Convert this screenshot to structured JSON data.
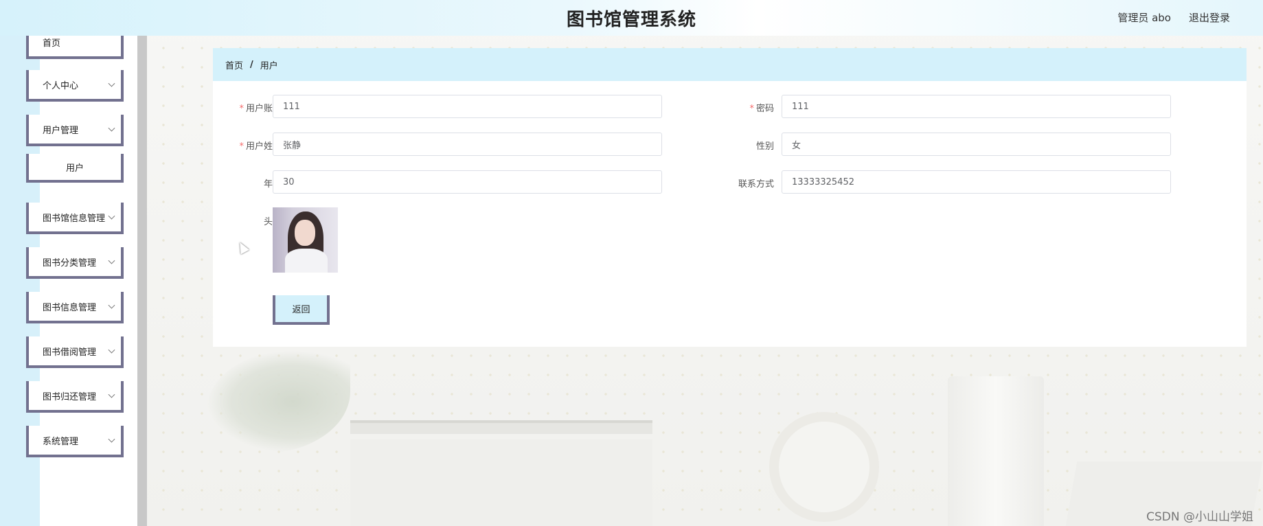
{
  "header": {
    "title": "图书馆管理系统",
    "user_label": "管理员 abo",
    "logout_label": "退出登录"
  },
  "sidebar": {
    "items": [
      {
        "label": "首页"
      },
      {
        "label": "个人中心"
      },
      {
        "label": "用户管理"
      },
      {
        "label": "用户"
      },
      {
        "label": "图书馆信息管理"
      },
      {
        "label": "图书分类管理"
      },
      {
        "label": "图书信息管理"
      },
      {
        "label": "图书借阅管理"
      },
      {
        "label": "图书归还管理"
      },
      {
        "label": "系统管理"
      }
    ]
  },
  "breadcrumb": {
    "home": "首页",
    "separator": "/",
    "current": "用户"
  },
  "form": {
    "account": {
      "label": "用户账号",
      "value": "111",
      "required": "*"
    },
    "password": {
      "label": "密码",
      "value": "111",
      "required": "*"
    },
    "name": {
      "label": "用户姓名",
      "value": "张静",
      "required": "*"
    },
    "gender": {
      "label": "性别",
      "value": "女"
    },
    "age": {
      "label": "年龄",
      "value": "30"
    },
    "contact": {
      "label": "联系方式",
      "value": "13333325452"
    },
    "avatar": {
      "label": "头像"
    },
    "back_label": "返回"
  },
  "watermark": "CSDN @小山山学姐",
  "colors": {
    "accent_light": "#d4f1fb",
    "menu_border": "#72718f",
    "required": "#f56c6c"
  }
}
